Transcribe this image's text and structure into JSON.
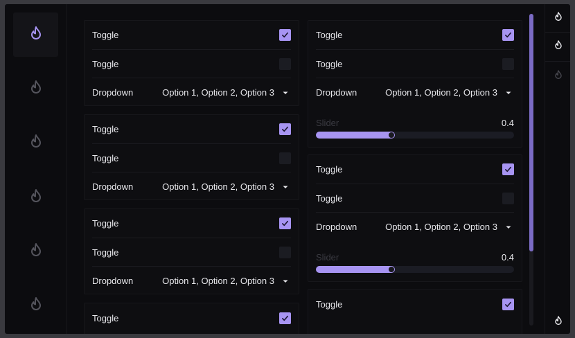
{
  "sidebar": {
    "items": [
      {
        "icon": "flame-icon",
        "active": true
      },
      {
        "icon": "flame-icon",
        "active": false
      },
      {
        "icon": "flame-icon",
        "active": false
      },
      {
        "icon": "flame-icon",
        "active": false
      },
      {
        "icon": "flame-icon",
        "active": false
      },
      {
        "icon": "flame-icon",
        "active": false
      }
    ]
  },
  "left_column": [
    {
      "toggle1": "Toggle",
      "toggle1_checked": true,
      "toggle2": "Toggle",
      "toggle2_checked": false,
      "dropdown_label": "Dropdown",
      "dropdown_value": "Option 1, Option 2, Option 3"
    },
    {
      "toggle1": "Toggle",
      "toggle1_checked": true,
      "toggle2": "Toggle",
      "toggle2_checked": false,
      "dropdown_label": "Dropdown",
      "dropdown_value": "Option 1, Option 2, Option 3"
    },
    {
      "toggle1": "Toggle",
      "toggle1_checked": true,
      "toggle2": "Toggle",
      "toggle2_checked": false,
      "dropdown_label": "Dropdown",
      "dropdown_value": "Option 1, Option 2, Option 3"
    },
    {
      "toggle1": "Toggle",
      "toggle1_checked": true
    }
  ],
  "right_column": [
    {
      "toggle1": "Toggle",
      "toggle1_checked": true,
      "toggle2": "Toggle",
      "toggle2_checked": false,
      "dropdown_label": "Dropdown",
      "dropdown_value": "Option 1, Option 2, Option 3",
      "slider_label": "Slider",
      "slider_value": "0.4",
      "slider_fraction": 0.4
    },
    {
      "toggle1": "Toggle",
      "toggle1_checked": true,
      "toggle2": "Toggle",
      "toggle2_checked": false,
      "dropdown_label": "Dropdown",
      "dropdown_value": "Option 1, Option 2, Option 3",
      "slider_label": "Slider",
      "slider_value": "0.4",
      "slider_fraction": 0.4
    },
    {
      "toggle1": "Toggle",
      "toggle1_checked": true
    }
  ],
  "colors": {
    "accent": "#a794f2",
    "accent_scrollbar": "#7b6bc4",
    "background": "#0c0c0f",
    "panel": "#0e0e11",
    "icon_inactive": "#5a5a62"
  },
  "rightbar": {
    "items": [
      {
        "icon": "flame-icon"
      },
      {
        "icon": "flame-icon"
      },
      {
        "icon": "flame-icon"
      },
      {
        "icon": "flame-icon"
      }
    ]
  }
}
